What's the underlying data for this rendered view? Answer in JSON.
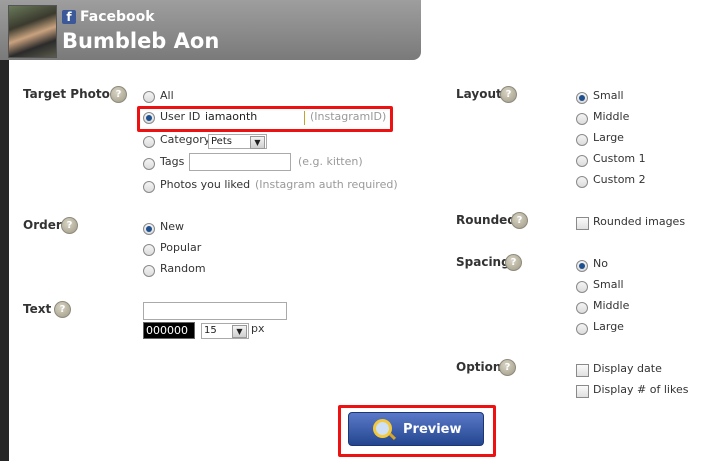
{
  "header": {
    "network_icon": "facebook-f-icon",
    "network_label": "Facebook",
    "user_name": "Bumbleb Aon"
  },
  "target_photos": {
    "label": "Target Photos",
    "help_icon": "help-question-icon",
    "help_glyph": "?",
    "options": {
      "all": "All",
      "user_id": "User ID",
      "category": "Category",
      "tags": "Tags",
      "liked": "Photos you liked"
    },
    "selected": "user_id",
    "user_id_value": "iamaonth",
    "user_id_hint": "(InstagramID)",
    "category_value": "Pets",
    "tags_value": "",
    "tags_hint": "(e.g. kitten)",
    "liked_hint": "(Instagram auth required)"
  },
  "order": {
    "label": "Order",
    "help_glyph": "?",
    "options": {
      "new": "New",
      "popular": "Popular",
      "random": "Random"
    },
    "selected": "new"
  },
  "text": {
    "label": "Text",
    "help_glyph": "?",
    "value": "",
    "color_value": "000000",
    "size_value": "15",
    "unit": "px"
  },
  "layout": {
    "label": "Layout",
    "help_glyph": "?",
    "options": {
      "small": "Small",
      "middle": "Middle",
      "large": "Large",
      "custom1": "Custom 1",
      "custom2": "Custom 2"
    },
    "selected": "small"
  },
  "rounded": {
    "label": "Rounded",
    "help_glyph": "?",
    "checkbox_label": "Rounded images",
    "checked": false
  },
  "spacing": {
    "label": "Spacing",
    "help_glyph": "?",
    "options": {
      "no": "No",
      "small": "Small",
      "middle": "Middle",
      "large": "Large"
    },
    "selected": "no"
  },
  "option": {
    "label": "Option",
    "help_glyph": "?",
    "display_date": "Display date",
    "display_likes": "Display # of likes"
  },
  "preview": {
    "label": "Preview",
    "icon": "magnifier-icon"
  },
  "colors": {
    "highlight": "#ee1111",
    "button": "#2f51a3",
    "radio_dot": "#1e4f8f"
  }
}
